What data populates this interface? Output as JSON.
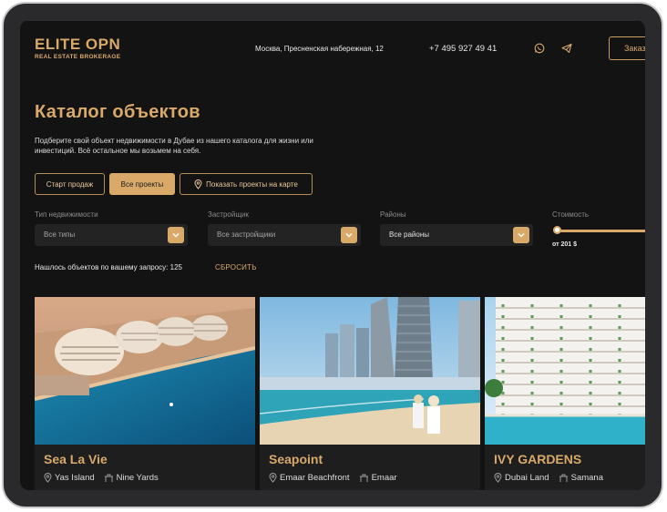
{
  "header": {
    "logo_title": "ELITE OPN",
    "logo_subtitle": "REAL ESTATE BROKERAGE",
    "address": "Москва, Пресненская набережная, 12",
    "phone": "+7 495 927 49 41",
    "order_button": "Заказ"
  },
  "hero": {
    "title": "Каталог объектов",
    "description": "Подберите свой объект недвижимости в Дубае из нашего каталога для жизни или инвестиций. Всё остальное мы возьмем на себя."
  },
  "filter_buttons": {
    "start_sales": "Старт продаж",
    "all_projects": "Все проекты",
    "show_map": "Показать проекты на карте"
  },
  "filters": {
    "type_label": "Тип недвижимости",
    "type_value": "Все типы",
    "developer_label": "Застройщик",
    "developer_value": "Все застройщики",
    "district_label": "Районы",
    "district_value": "Все районы",
    "price_label": "Стоимость",
    "price_from": "от 201 $",
    "price_slider_fraction": 0.0
  },
  "results": {
    "found_text": "Нашлось объектов по вашему запросу: 125",
    "reset_label": "СБРОСИТЬ"
  },
  "cards": [
    {
      "name": "Sea La Vie",
      "location": "Yas Island",
      "developer": "Nine Yards"
    },
    {
      "name": "Seapoint",
      "location": "Emaar Beachfront",
      "developer": "Emaar"
    },
    {
      "name": "IVY GARDENS",
      "location": "Dubai Land",
      "developer": "Samana"
    }
  ],
  "colors": {
    "accent": "#d9a96a",
    "background": "#131313",
    "panel": "#232323"
  },
  "icons": [
    "whatsapp-icon",
    "telegram-icon",
    "map-pin-icon",
    "chevron-down-icon",
    "developer-icon"
  ]
}
